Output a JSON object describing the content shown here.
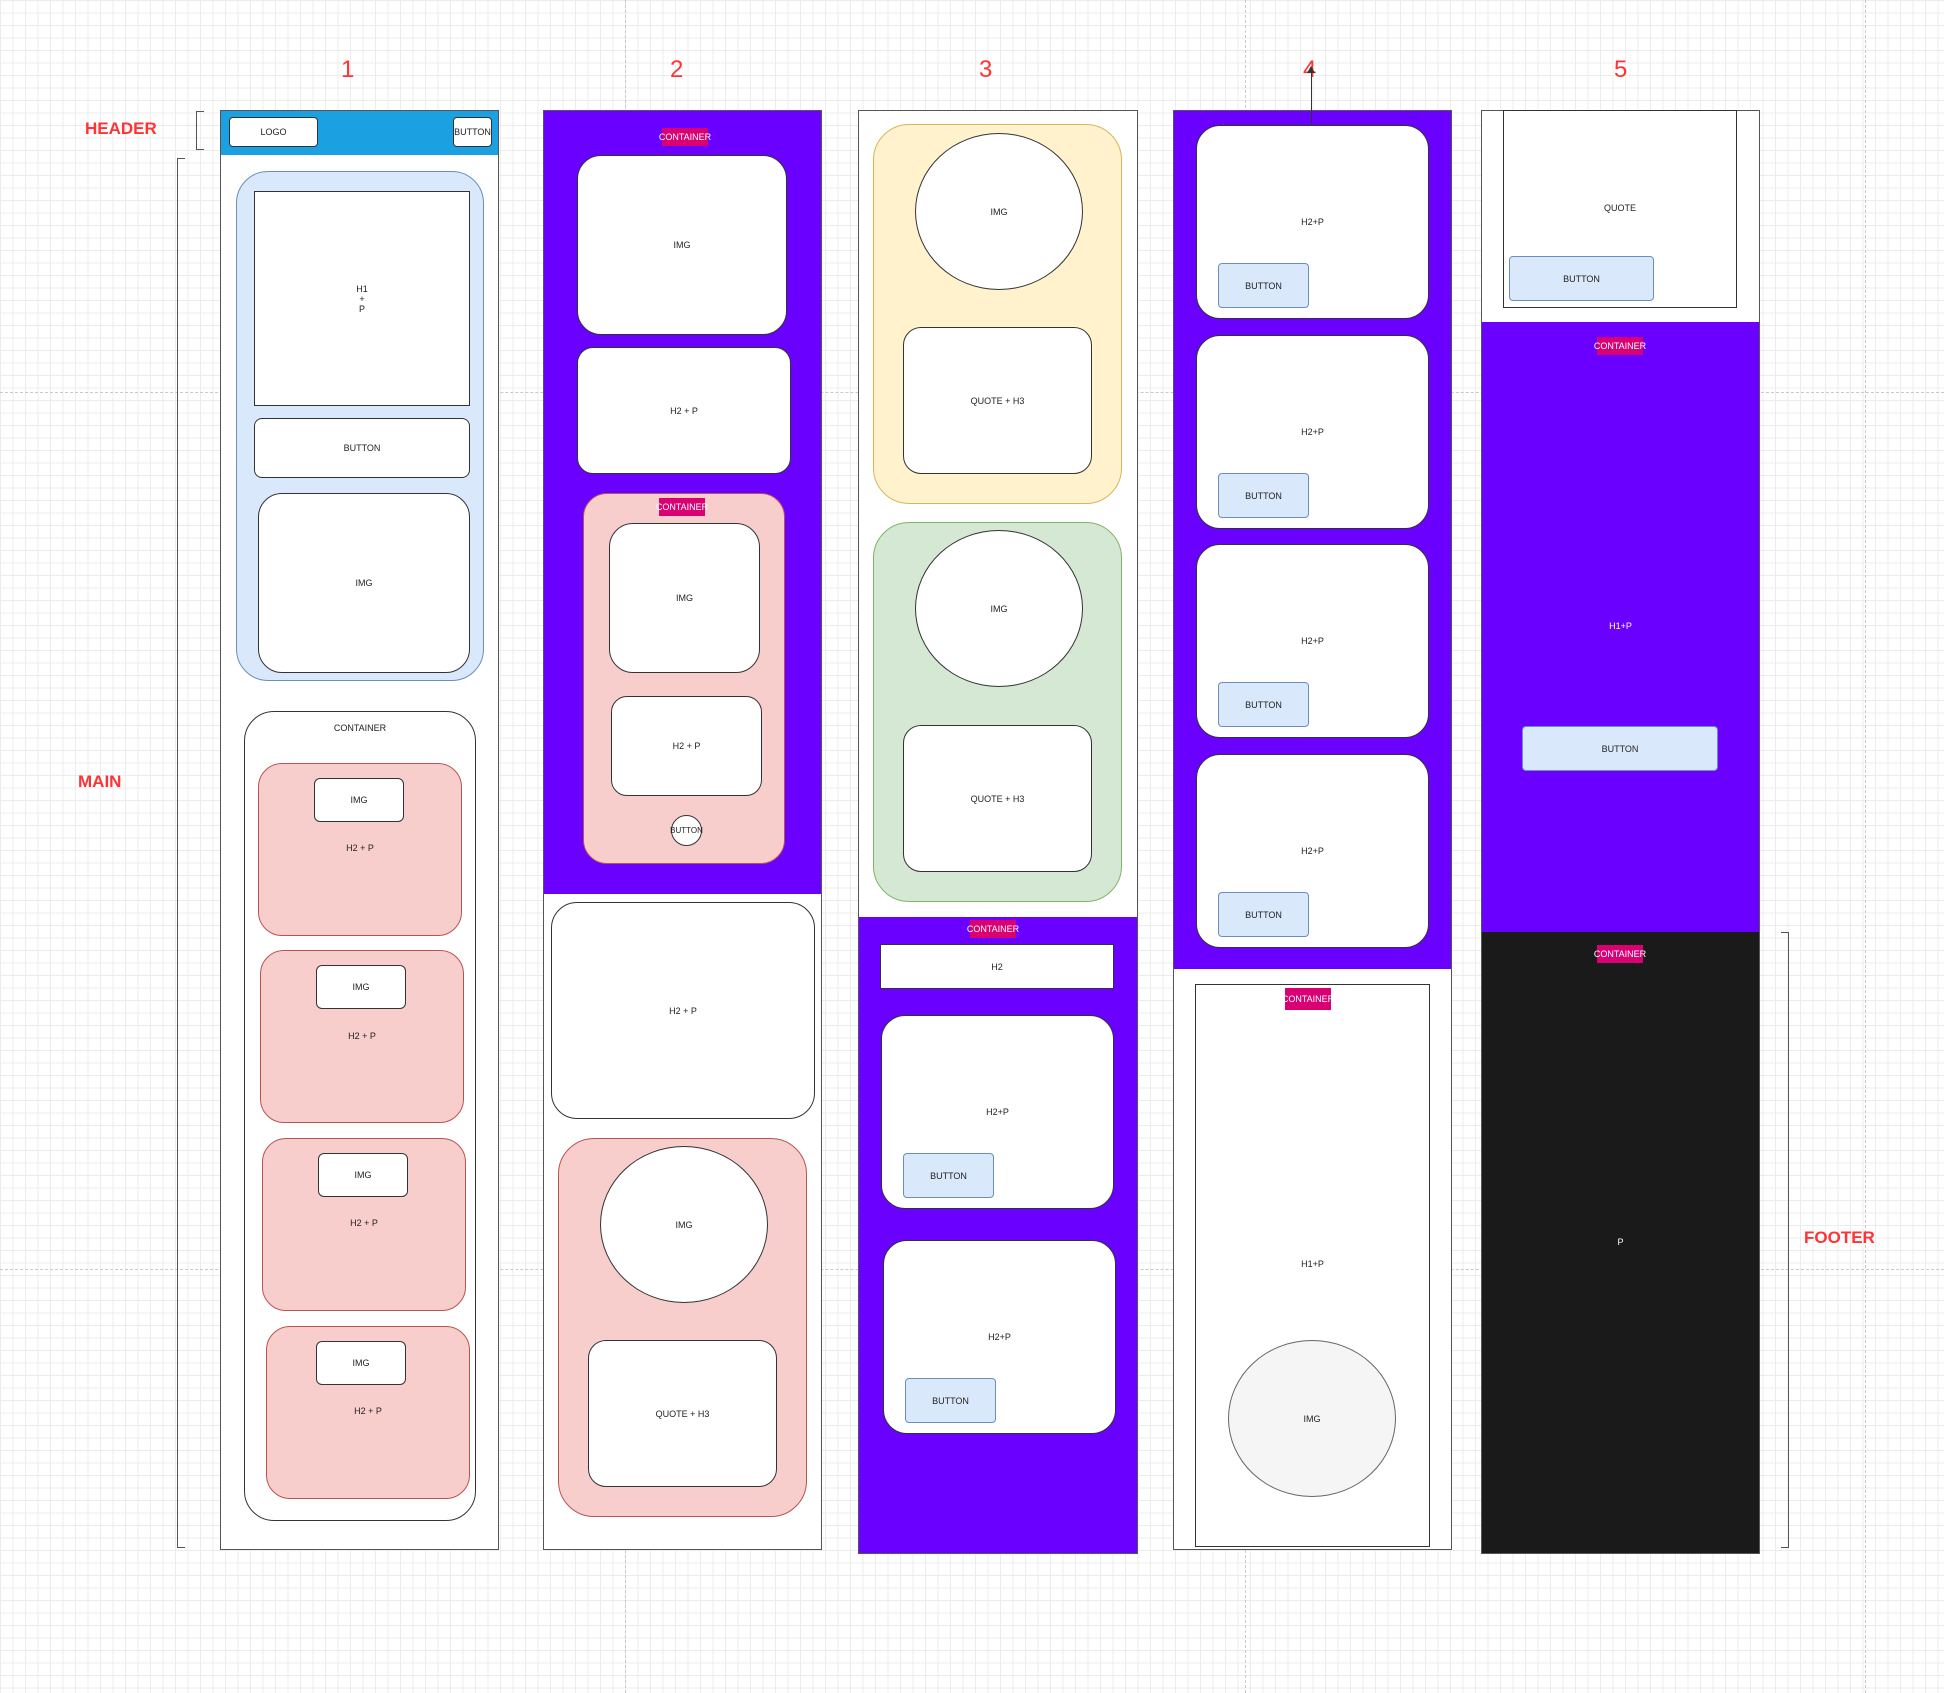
{
  "columns": {
    "c1": "1",
    "c2": "2",
    "c3": "3",
    "c4": "4",
    "c5": "5"
  },
  "sections": {
    "header": "HEADER",
    "main": "MAIN",
    "footer": "FOOTER"
  },
  "labels": {
    "logo": "LOGO",
    "button": "BUTTON",
    "h1p_stack": "H1\n+\nP",
    "img": "IMG",
    "container": "CONTAINER",
    "h2_p_spaced": "H2 + P",
    "h2p": "H2+P",
    "quote_h3": "QUOTE + H3",
    "h2": "H2",
    "quote": "QUOTE",
    "h1p": "H1+P",
    "p": "P"
  },
  "colors": {
    "purple": "#6a00ff",
    "magenta": "#d80073",
    "footer": "#1a1a1a",
    "header_blue": "#1ba1e2"
  }
}
